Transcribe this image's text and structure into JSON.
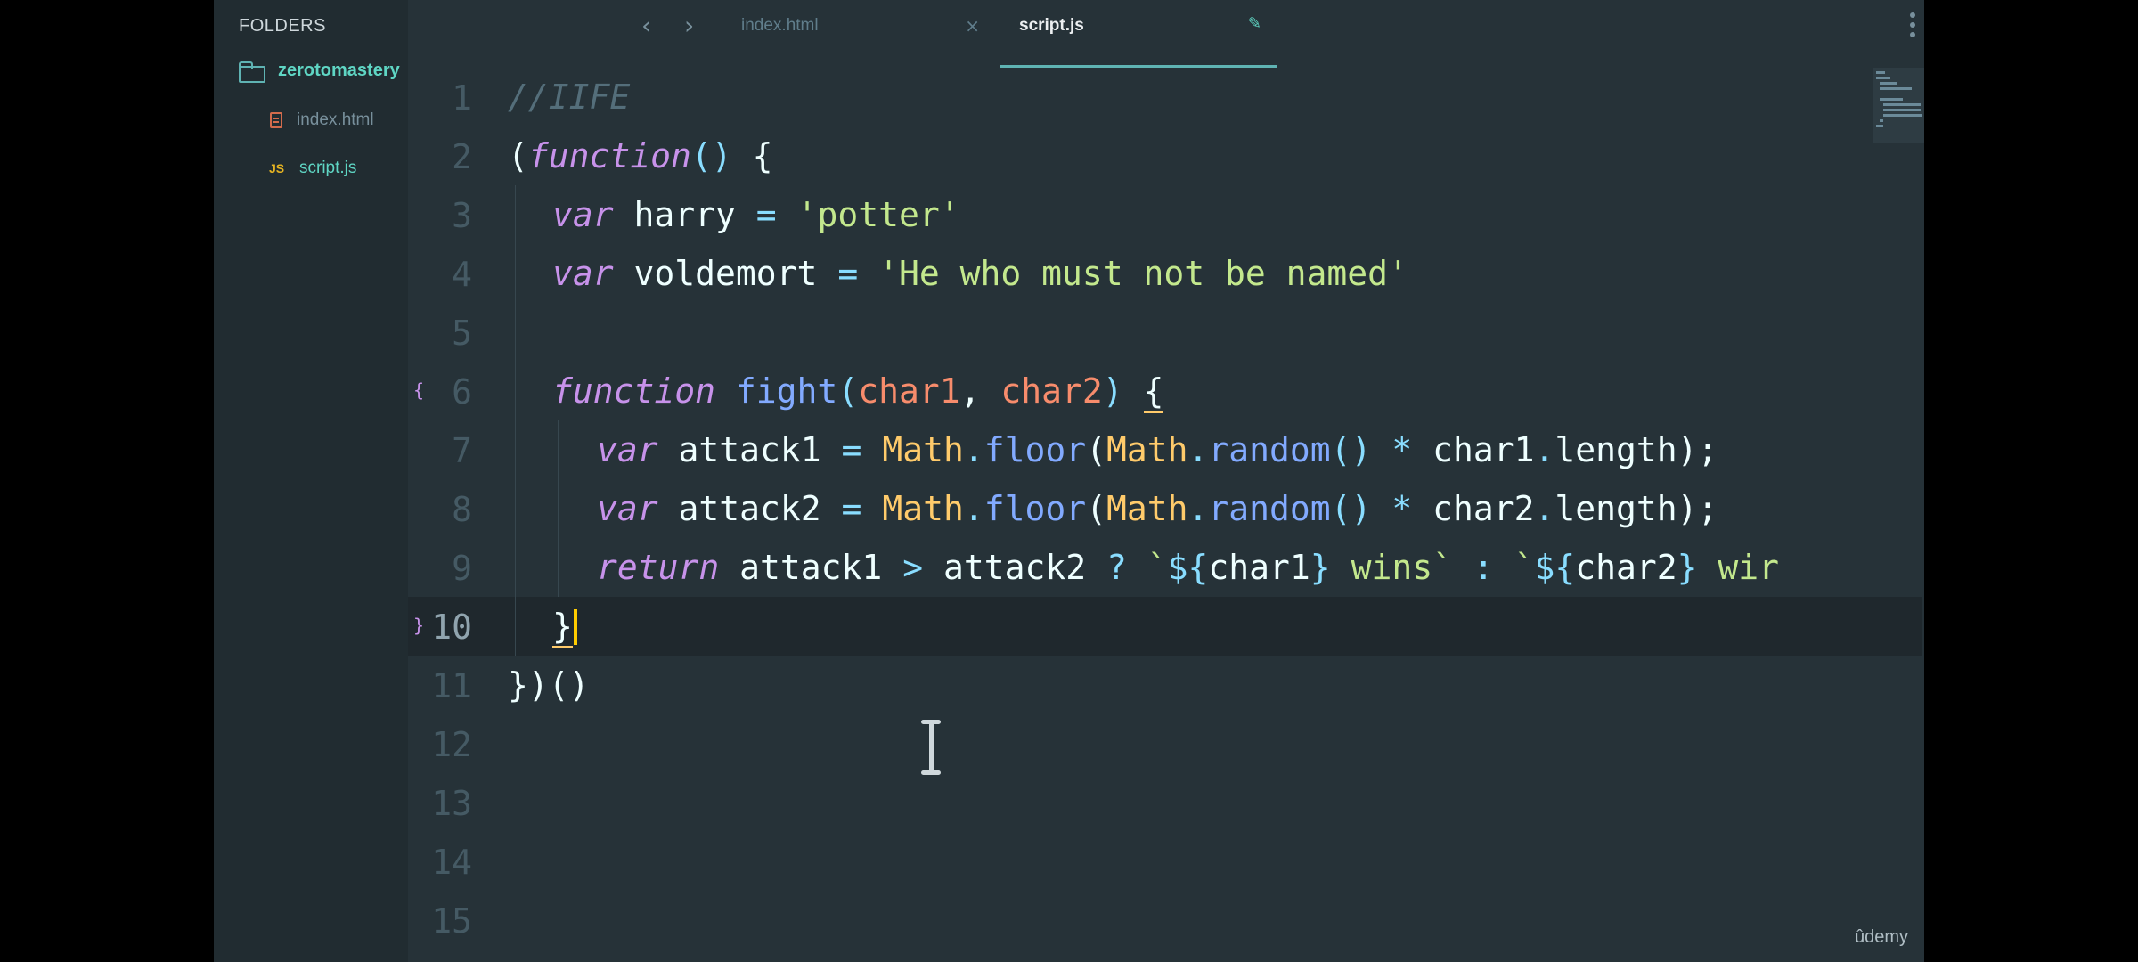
{
  "sidebar": {
    "title": "FOLDERS",
    "folder": {
      "label": "zerotomastery",
      "icon": "folder-icon"
    },
    "files": [
      {
        "label": "index.html",
        "icon": "html-file-icon"
      },
      {
        "label": "script.js",
        "icon_text": "JS"
      }
    ]
  },
  "tabs": {
    "back_glyph": "‹",
    "forward_glyph": "›",
    "items": [
      {
        "label": "index.html",
        "close_glyph": "×",
        "active": false
      },
      {
        "label": "script.js",
        "edit_glyph": "✎",
        "active": true
      }
    ]
  },
  "editor": {
    "current_line": 10,
    "lines": [
      {
        "number": "1"
      },
      {
        "number": "2"
      },
      {
        "number": "3"
      },
      {
        "number": "4"
      },
      {
        "number": "5"
      },
      {
        "number": "6",
        "fold": "{"
      },
      {
        "number": "7"
      },
      {
        "number": "8"
      },
      {
        "number": "9"
      },
      {
        "number": "10",
        "fold": "}"
      },
      {
        "number": "11"
      },
      {
        "number": "12"
      },
      {
        "number": "13"
      },
      {
        "number": "14"
      },
      {
        "number": "15"
      }
    ],
    "code": {
      "l1_comment": "//IIFE",
      "l2_open": "(",
      "l2_function": "function",
      "l2_parens": "()",
      "l2_brace": " {",
      "l3_var": "var",
      "l3_name": " harry ",
      "l3_eq": "=",
      "l3_str": " 'potter'",
      "l4_var": "var",
      "l4_name": " voldemort ",
      "l4_eq": "=",
      "l4_str": " 'He who must not be named'",
      "l6_function": "function",
      "l6_name": " fight",
      "l6_open": "(",
      "l6_p1": "char1",
      "l6_comma": ", ",
      "l6_p2": "char2",
      "l6_close": ")",
      "l6_brace": "{",
      "l7_var": "var",
      "l7_name": " attack1 ",
      "l7_eq": "=",
      "l7_math1": " Math",
      "l7_dot1": ".",
      "l7_floor": "floor",
      "l7_paren1": "(",
      "l7_math2": "Math",
      "l7_dot2": ".",
      "l7_random": "random",
      "l7_call": "()",
      "l7_star": " * ",
      "l7_char": "char1",
      "l7_dot3": ".",
      "l7_len": "length",
      "l7_end": ");",
      "l8_var": "var",
      "l8_name": " attack2 ",
      "l8_eq": "=",
      "l8_math1": " Math",
      "l8_dot1": ".",
      "l8_floor": "floor",
      "l8_paren1": "(",
      "l8_math2": "Math",
      "l8_dot2": ".",
      "l8_random": "random",
      "l8_call": "()",
      "l8_star": " * ",
      "l8_char": "char2",
      "l8_dot3": ".",
      "l8_len": "length",
      "l8_end": ");",
      "l9_return": "return",
      "l9_a1": " attack1 ",
      "l9_gt": ">",
      "l9_a2": " attack2 ",
      "l9_q": "?",
      "l9_tick1": " `",
      "l9_dollar1": "${",
      "l9_c1": "char1",
      "l9_close1": "}",
      "l9_wins1": " wins",
      "l9_tick2": "`",
      "l9_colon": " : ",
      "l9_tick3": "`",
      "l9_dollar2": "${",
      "l9_c2": "char2",
      "l9_close2": "}",
      "l9_wins2": " wir",
      "l10_brace": "}",
      "l11_code": "})()"
    }
  },
  "watermark": "ûdemy",
  "colors": {
    "background": "#263238",
    "sidebar": "#212c31",
    "accent": "#5fd6c4",
    "keyword": "#c792ea",
    "function": "#82aaff",
    "string": "#c3e88d",
    "parameter": "#f78c6c",
    "class": "#ffcb6b",
    "cursor": "#ffcc00"
  }
}
